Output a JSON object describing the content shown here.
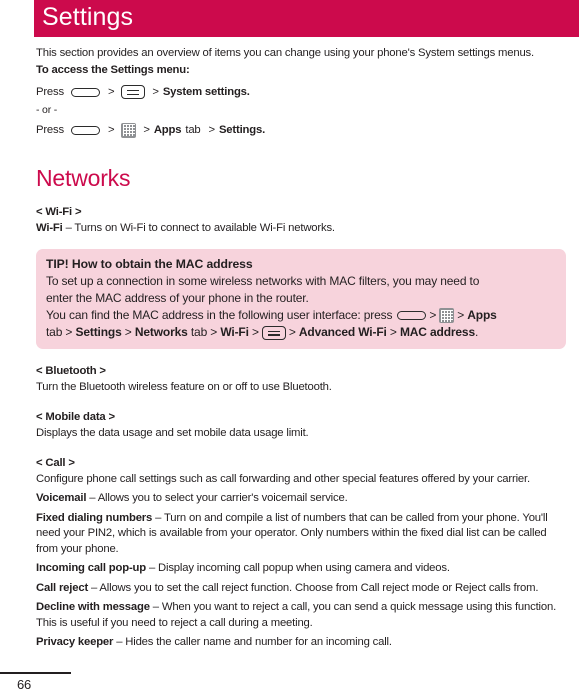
{
  "header": {
    "title": "Settings",
    "bar_color": "#cc0a4c"
  },
  "intro": {
    "paragraph": "This section provides an overview of items you can change using your phone's System settings menus.",
    "access_label": "To access the Settings menu:"
  },
  "access_steps": {
    "press_word": "Press",
    "separator": ">",
    "step1_target": "System settings.",
    "or_text": "- or -",
    "step2_apps": "Apps",
    "step2_tab": "tab",
    "step2_target": "Settings.",
    "icons": {
      "home": "home-key-icon",
      "menu": "menu-key-icon",
      "apps": "apps-grid-icon"
    }
  },
  "networks": {
    "heading": "Networks",
    "wifi": {
      "tag": "< Wi-Fi >",
      "term": "Wi-Fi",
      "description": " – Turns on Wi-Fi to connect to available Wi-Fi networks."
    },
    "tip": {
      "title": "TIP! How to obtain the MAC address",
      "line1": "To set up a connection in some wireless networks with MAC filters, you may need to",
      "line2": "enter the MAC address of your phone in the router.",
      "line3_prefix": "You can find the MAC address in the following user interface: press",
      "line3_apps": "Apps",
      "line4_tab": "tab >",
      "line4_settings": "Settings",
      "line4_networks": "Networks",
      "line4_tab2": "tab >",
      "line4_wifi": "Wi-Fi",
      "line4_advanced": "Advanced Wi-Fi",
      "line4_mac": "MAC address",
      "separator": ">",
      "period": ".",
      "bg_color": "#f7d3dc"
    },
    "bluetooth": {
      "tag": "< Bluetooth >",
      "description": "Turn the Bluetooth wireless feature on or off to use Bluetooth."
    },
    "mobile_data": {
      "tag": "< Mobile data >",
      "description": "Displays the data usage and set mobile data usage limit."
    },
    "call": {
      "tag": "< Call >",
      "description": "Configure phone call settings such as call forwarding and other special features offered by your carrier.",
      "items": [
        {
          "term": "Voicemail",
          "text": " – Allows you to select your carrier's voicemail service."
        },
        {
          "term": "Fixed dialing numbers",
          "text": " – Turn on and compile a list of numbers that can be called from your phone. You'll need your PIN2, which is available from your operator. Only numbers within the fixed dial list can be called from your phone."
        },
        {
          "term": "Incoming call pop-up",
          "text": " – Display incoming call popup when using camera and videos."
        },
        {
          "term": "Call reject",
          "text": " – Allows you to set the call reject function. Choose from Call reject mode or Reject calls from."
        },
        {
          "term": "Decline with message",
          "text": " – When you want to reject a call, you can send a quick message using this function. This is useful if you need to reject a call during a meeting."
        },
        {
          "term": "Privacy keeper",
          "text": " – Hides the caller name and number for an incoming call."
        }
      ]
    }
  },
  "footer": {
    "page_number": "66"
  }
}
